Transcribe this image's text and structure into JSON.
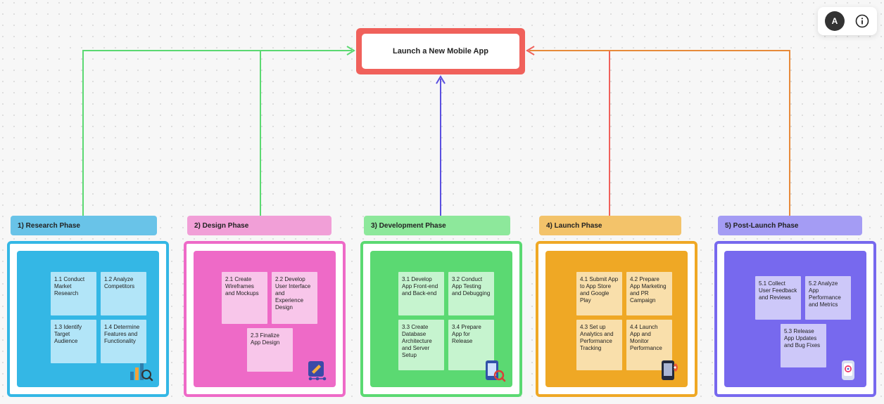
{
  "toolbar": {
    "avatar_letter": "A"
  },
  "root": {
    "title": "Launch a New Mobile App"
  },
  "colors": {
    "phase1_line": "#5bd972",
    "phase2_line": "#5bd972",
    "phase3_line": "#5a4fe0",
    "phase4_line": "#f0615b",
    "phase5_line": "#e78a3a"
  },
  "phases": [
    {
      "id": 1,
      "label": "1) Research Phase",
      "cards": [
        "1.1 Conduct Market Research",
        "1.2 Analyze Competitors",
        "1.3 Identify Target Audience",
        "1.4 Determine Features and Functionality"
      ]
    },
    {
      "id": 2,
      "label": "2) Design  Phase",
      "cards": [
        "2.1 Create Wireframes and Mockups",
        "2.2 Develop User Interface and Experience Design",
        "2.3 Finalize App Design"
      ]
    },
    {
      "id": 3,
      "label": "3) Development  Phase",
      "cards": [
        "3.1 Develop App Front-end and Back-end",
        "3.2 Conduct App Testing and Debugging",
        "3.3 Create Database Architecture and Server Setup",
        "3.4 Prepare App for Release"
      ]
    },
    {
      "id": 4,
      "label": "4) Launch  Phase",
      "cards": [
        "4.1 Submit App to App Store and Google Play",
        "4.2 Prepare App Marketing and PR Campaign",
        "4.3 Set up Analytics and Performance Tracking",
        "4.4 Launch App and Monitor Performance"
      ]
    },
    {
      "id": 5,
      "label": "5) Post-Launch  Phase",
      "cards": [
        "5.1 Collect User Feedback and Reviews",
        "5.2 Analyze App Performance and Metrics",
        "5.3 Release App Updates and Bug Fixes"
      ]
    }
  ],
  "chart_data": {
    "type": "table",
    "title": "Launch a New Mobile App — Work Breakdown Structure",
    "root": "Launch a New Mobile App",
    "phases": [
      {
        "phase": "1) Research Phase",
        "tasks": [
          "1.1 Conduct Market Research",
          "1.2 Analyze Competitors",
          "1.3 Identify Target Audience",
          "1.4 Determine Features and Functionality"
        ]
      },
      {
        "phase": "2) Design Phase",
        "tasks": [
          "2.1 Create Wireframes and Mockups",
          "2.2 Develop User Interface and Experience Design",
          "2.3 Finalize App Design"
        ]
      },
      {
        "phase": "3) Development Phase",
        "tasks": [
          "3.1 Develop App Front-end and Back-end",
          "3.2 Conduct App Testing and Debugging",
          "3.3 Create Database Architecture and Server Setup",
          "3.4 Prepare App for Release"
        ]
      },
      {
        "phase": "4) Launch Phase",
        "tasks": [
          "4.1 Submit App to App Store and Google Play",
          "4.2 Prepare App Marketing and PR Campaign",
          "4.3 Set up Analytics and Performance Tracking",
          "4.4 Launch App and Monitor Performance"
        ]
      },
      {
        "phase": "5) Post-Launch Phase",
        "tasks": [
          "5.1 Collect User Feedback and Reviews",
          "5.2 Analyze App Performance and Metrics",
          "5.3 Release App Updates and Bug Fixes"
        ]
      }
    ]
  }
}
